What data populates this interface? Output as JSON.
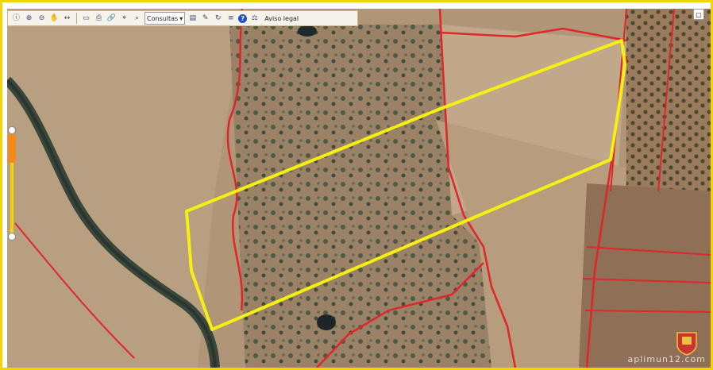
{
  "toolbar": {
    "buttons": [
      "info-icon",
      "zoom-in-icon",
      "zoom-out-icon",
      "pan-icon",
      "measure-icon",
      "area-icon",
      "print-icon",
      "link-icon",
      "search-icon",
      "coords-icon"
    ],
    "layer_select": "Consultas",
    "legal_label": "Aviso legal"
  },
  "watermark": "aplimun12.com",
  "colors": {
    "parcel_boundary": "#e0262a",
    "selection_outline": "#f5ef12",
    "frame": "#f2d400",
    "zoom_handle": "#f48a1a"
  }
}
